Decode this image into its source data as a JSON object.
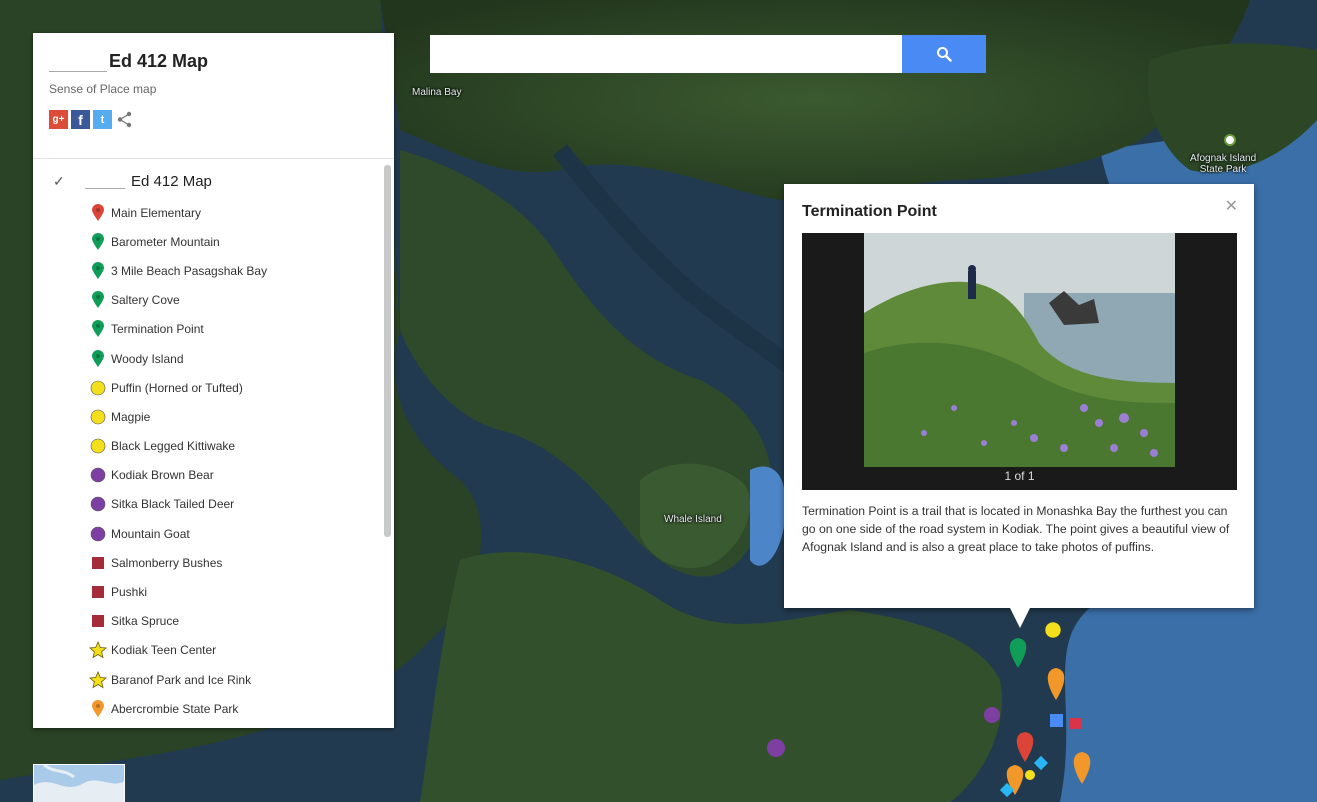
{
  "header": {
    "title": "Ed 412 Map",
    "subtitle": "Sense of Place map"
  },
  "search": {
    "value": "",
    "placeholder": ""
  },
  "share_icons": [
    "google-plus-icon",
    "facebook-icon",
    "twitter-icon",
    "share-icon"
  ],
  "layer": {
    "title": "Ed 412 Map",
    "items": [
      {
        "label": "Main Elementary",
        "icon": "pin",
        "color": "#db4437"
      },
      {
        "label": "Barometer Mountain",
        "icon": "pin",
        "color": "#0f9d58"
      },
      {
        "label": "3 Mile Beach Pasagshak Bay",
        "icon": "pin",
        "color": "#0f9d58"
      },
      {
        "label": "Saltery Cove",
        "icon": "pin",
        "color": "#0f9d58"
      },
      {
        "label": "Termination Point",
        "icon": "pin",
        "color": "#0f9d58"
      },
      {
        "label": "Woody Island",
        "icon": "pin",
        "color": "#0f9d58"
      },
      {
        "label": "Puffin (Horned or Tufted)",
        "icon": "circle",
        "color": "#f4df1c"
      },
      {
        "label": "Magpie",
        "icon": "circle",
        "color": "#f4df1c"
      },
      {
        "label": "Black Legged Kittiwake",
        "icon": "circle",
        "color": "#f4df1c"
      },
      {
        "label": "Kodiak Brown Bear",
        "icon": "circle",
        "color": "#7e3fa2"
      },
      {
        "label": "Sitka Black Tailed Deer",
        "icon": "circle",
        "color": "#7e3fa2"
      },
      {
        "label": "Mountain Goat",
        "icon": "circle",
        "color": "#7e3fa2"
      },
      {
        "label": "Salmonberry Bushes",
        "icon": "square",
        "color": "#a52a3a"
      },
      {
        "label": "Pushki",
        "icon": "square",
        "color": "#a52a3a"
      },
      {
        "label": "Sitka Spruce",
        "icon": "square",
        "color": "#a52a3a"
      },
      {
        "label": "Kodiak Teen Center",
        "icon": "star",
        "color": "#f4df1c"
      },
      {
        "label": "Baranof Park and Ice Rink",
        "icon": "star",
        "color": "#f4df1c"
      },
      {
        "label": "Abercrombie State Park",
        "icon": "pin",
        "color": "#f2972a"
      }
    ]
  },
  "info_window": {
    "title": "Termination Point",
    "counter": "1 of 1",
    "description": "Termination Point is a trail that is located in Monashka Bay the furthest you can go on one side of the road system in Kodiak. The point gives a beautiful view of Afognak Island and is also a great place to take photos of puffins."
  },
  "map_labels": {
    "bay": "Malina Bay",
    "island": "Whale Island",
    "park_line1": "Afognak Island",
    "park_line2": "State Park"
  },
  "colors": {
    "search_button": "#4a8af4",
    "water": "#2f5a8c",
    "land": "#2d4526"
  }
}
